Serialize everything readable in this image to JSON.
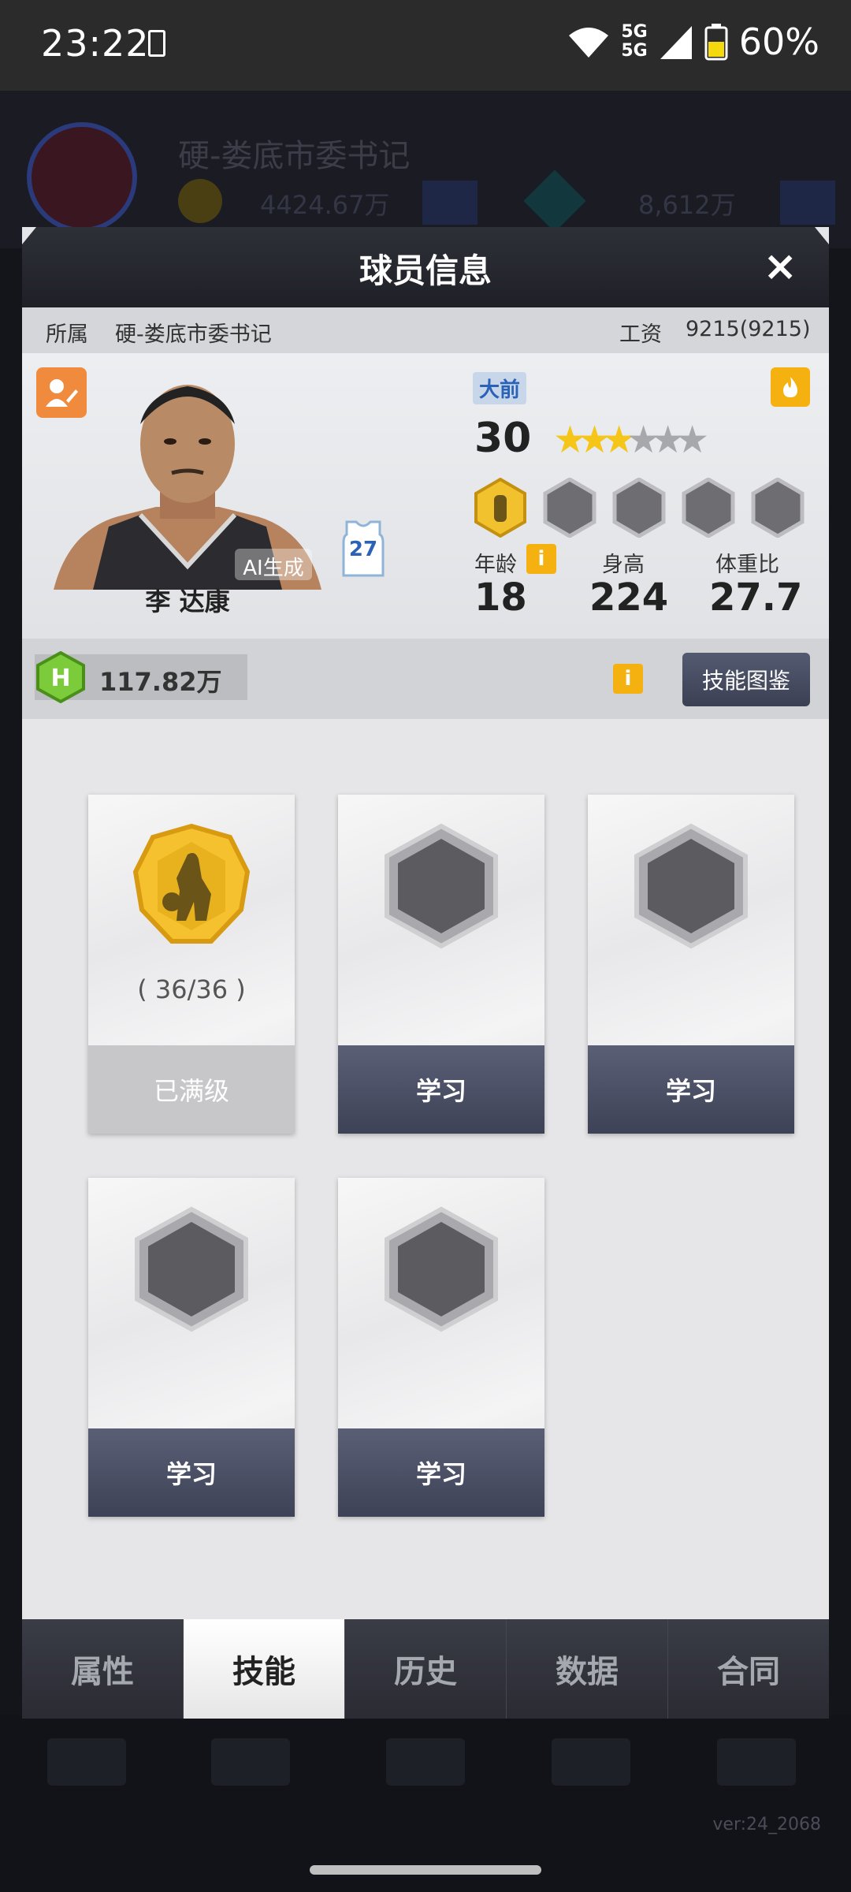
{
  "status_bar": {
    "time": "23:22",
    "network": "5G",
    "battery": "60%"
  },
  "background": {
    "team_name": "硬-娄底市委书记",
    "currency1": "4424.67万",
    "currency2": "8,612万"
  },
  "modal": {
    "title": "球员信息",
    "close": "×",
    "info": {
      "team_label": "所属",
      "team_value": "硬-娄底市委书记",
      "salary_label": "工资",
      "salary_value": "9215(9215)"
    },
    "player": {
      "name": "李 达康",
      "ai_tag": "AI生成",
      "jersey_number": "27",
      "position": "大前",
      "overall": "30",
      "stars_filled": 3,
      "stars_total": 6,
      "stats": [
        {
          "label": "年龄",
          "value": "18"
        },
        {
          "label": "身高",
          "value": "224"
        },
        {
          "label": "体重比",
          "value": "27.7"
        }
      ]
    },
    "points": {
      "value": "117.82万",
      "catalog_button": "技能图鉴"
    },
    "skills": [
      {
        "state": "maxed",
        "level": "( 36/36 )",
        "button": "已满级"
      },
      {
        "state": "locked",
        "level": "",
        "button": "学习"
      },
      {
        "state": "locked",
        "level": "",
        "button": "学习"
      },
      {
        "state": "locked",
        "level": "",
        "button": "学习"
      },
      {
        "state": "locked",
        "level": "",
        "button": "学习"
      }
    ],
    "tabs": [
      {
        "label": "属性",
        "active": false
      },
      {
        "label": "技能",
        "active": true
      },
      {
        "label": "历史",
        "active": false
      },
      {
        "label": "数据",
        "active": false
      },
      {
        "label": "合同",
        "active": false
      }
    ]
  },
  "version": "ver:24_2068",
  "colors": {
    "gold": "#f5b10f",
    "button_dark": "#3d4256",
    "edit_orange": "#f08a3c",
    "position_blue": "#2a62b8"
  }
}
